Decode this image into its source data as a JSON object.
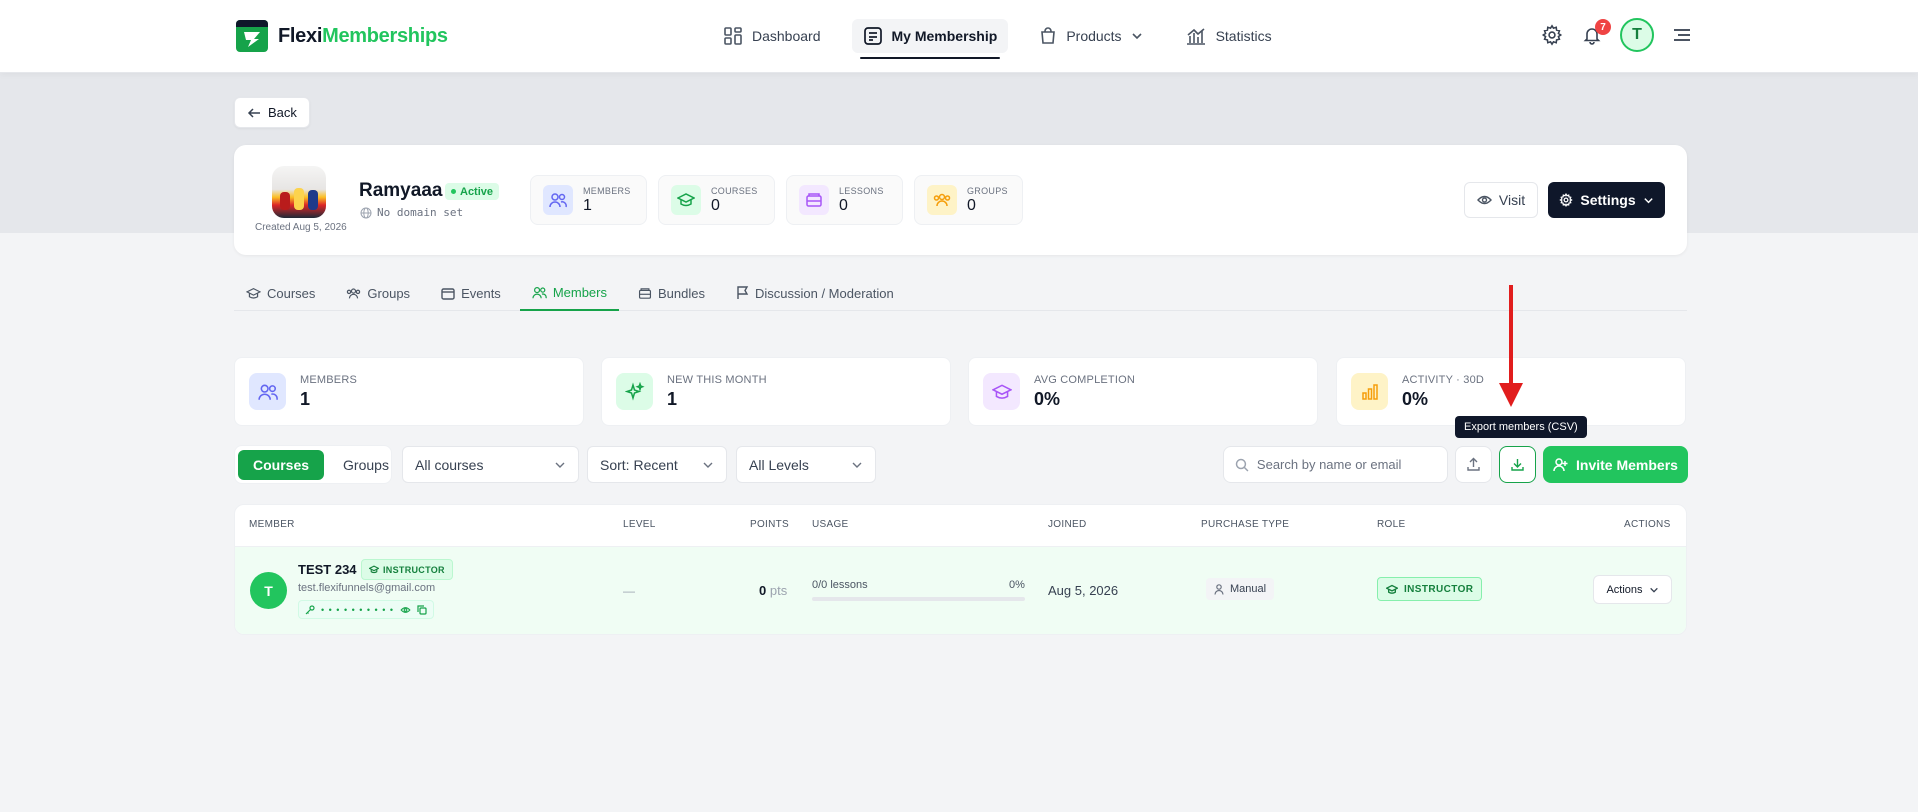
{
  "brand": {
    "name_a": "Flexi",
    "name_b": "Memberships"
  },
  "nav": {
    "items": [
      {
        "label": "Dashboard"
      },
      {
        "label": "My Membership"
      },
      {
        "label": "Products"
      },
      {
        "label": "Statistics"
      }
    ],
    "notifications_count": "7",
    "user_initial": "T"
  },
  "back_label": "Back",
  "membership": {
    "name": "Ramyaaa",
    "status": "Active",
    "domain": "No domain set",
    "created": "Created Aug 5, 2026",
    "mini_stats": [
      {
        "label": "MEMBERS",
        "value": "1"
      },
      {
        "label": "COURSES",
        "value": "0"
      },
      {
        "label": "LESSONS",
        "value": "0"
      },
      {
        "label": "GROUPS",
        "value": "0"
      }
    ],
    "visit_label": "Visit",
    "settings_label": "Settings"
  },
  "tabs": [
    {
      "label": "Courses"
    },
    {
      "label": "Groups"
    },
    {
      "label": "Events"
    },
    {
      "label": "Members"
    },
    {
      "label": "Bundles"
    },
    {
      "label": "Discussion / Moderation"
    }
  ],
  "stats": [
    {
      "label": "MEMBERS",
      "value": "1"
    },
    {
      "label": "NEW THIS MONTH",
      "value": "1"
    },
    {
      "label": "AVG COMPLETION",
      "value": "0%"
    },
    {
      "label": "ACTIVITY · 30D",
      "value": "0%"
    }
  ],
  "tooltip": "Export members (CSV)",
  "toolbar": {
    "seg_courses": "Courses",
    "seg_groups": "Groups",
    "filter_courses": "All courses",
    "sort": "Sort: Recent",
    "levels": "All Levels",
    "search_placeholder": "Search by name or email",
    "invite_label": "Invite Members"
  },
  "table": {
    "headers": {
      "member": "MEMBER",
      "level": "LEVEL",
      "points": "POINTS",
      "usage": "USAGE",
      "joined": "JOINED",
      "purchase_type": "PURCHASE TYPE",
      "role": "ROLE",
      "actions": "ACTIONS"
    },
    "rows": [
      {
        "initial": "T",
        "name": "TEST 234",
        "badge": "INSTRUCTOR",
        "email": "test.flexifunnels@gmail.com",
        "password_mask": "• • • • • • • • • •",
        "level": "—",
        "points": "0",
        "points_unit": "pts",
        "usage_label": "0/0 lessons",
        "usage_pct": "0%",
        "usage_fraction": 0,
        "joined": "Aug 5, 2026",
        "purchase_type": "Manual",
        "role": "INSTRUCTOR",
        "actions_label": "Actions"
      }
    ]
  },
  "colors": {
    "accent_green": "#22c55e",
    "dark": "#0f172a",
    "arrow_red": "#e11d1d"
  }
}
